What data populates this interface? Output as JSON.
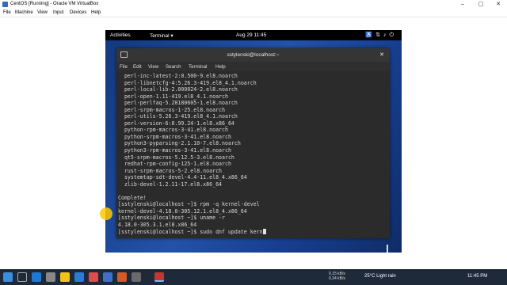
{
  "vbox": {
    "title": "CentOS [Running] - Oracle VM VirtualBox",
    "menu": [
      "File",
      "Machine",
      "View",
      "Input",
      "Devices",
      "Help"
    ]
  },
  "gnome": {
    "activities": "Activities",
    "app_menu": "Terminal ▾",
    "clock": "Aug 29  11:45"
  },
  "terminal": {
    "title": "sstylenski@localhost:~",
    "menu": [
      "File",
      "Edit",
      "View",
      "Search",
      "Terminal",
      "Help"
    ],
    "lines": [
      "  perl-inc-latest-2:0.500-9.el8.noarch",
      "  perl-libnetcfg-4:5.26.3-419.el8_4.1.noarch",
      "  perl-local-lib-2.000024-2.el8.noarch",
      "  perl-open-1.11-419.el8_4.1.noarch",
      "  perl-perlfaq-5.20180605-1.el8.noarch",
      "  perl-srpm-macros-1-25.el8.noarch",
      "  perl-utils-5.26.3-419.el8_4.1.noarch",
      "  perl-version-6:0.99.24-1.el8.x86_64",
      "  python-rpm-macros-3-41.el8.noarch",
      "  python-srpm-macros-3-41.el8.noarch",
      "  python3-pyparsing-2.1.10-7.el8.noarch",
      "  python3-rpm-macros-3-41.el8.noarch",
      "  qt5-srpm-macros-5.12.5-3.el8.noarch",
      "  redhat-rpm-config-125-1.el8.noarch",
      "  rust-srpm-macros-5-2.el8.noarch",
      "  systemtap-sdt-devel-4.4-11.el8_4.x86_64",
      "  zlib-devel-1.2.11-17.el8.x86_64",
      "",
      "Complete!",
      "[sstylenski@localhost ~]$ rpm -q kernel-devel",
      "kernel-devel-4.18.0-305.12.1.el8_4.x86_64",
      "[sstylenski@localhost ~]$ uname -r",
      "4.18.0-305.3.1.el8.x86_64"
    ],
    "prompt_line": "[sstylenski@localhost ~]$ sudo dnf update kern"
  },
  "taskbar": {
    "weather": "25°C  Light rain",
    "net_up": "0.15 kB/s",
    "net_down": "0.34 kB/s",
    "time": "11:45 PM"
  }
}
